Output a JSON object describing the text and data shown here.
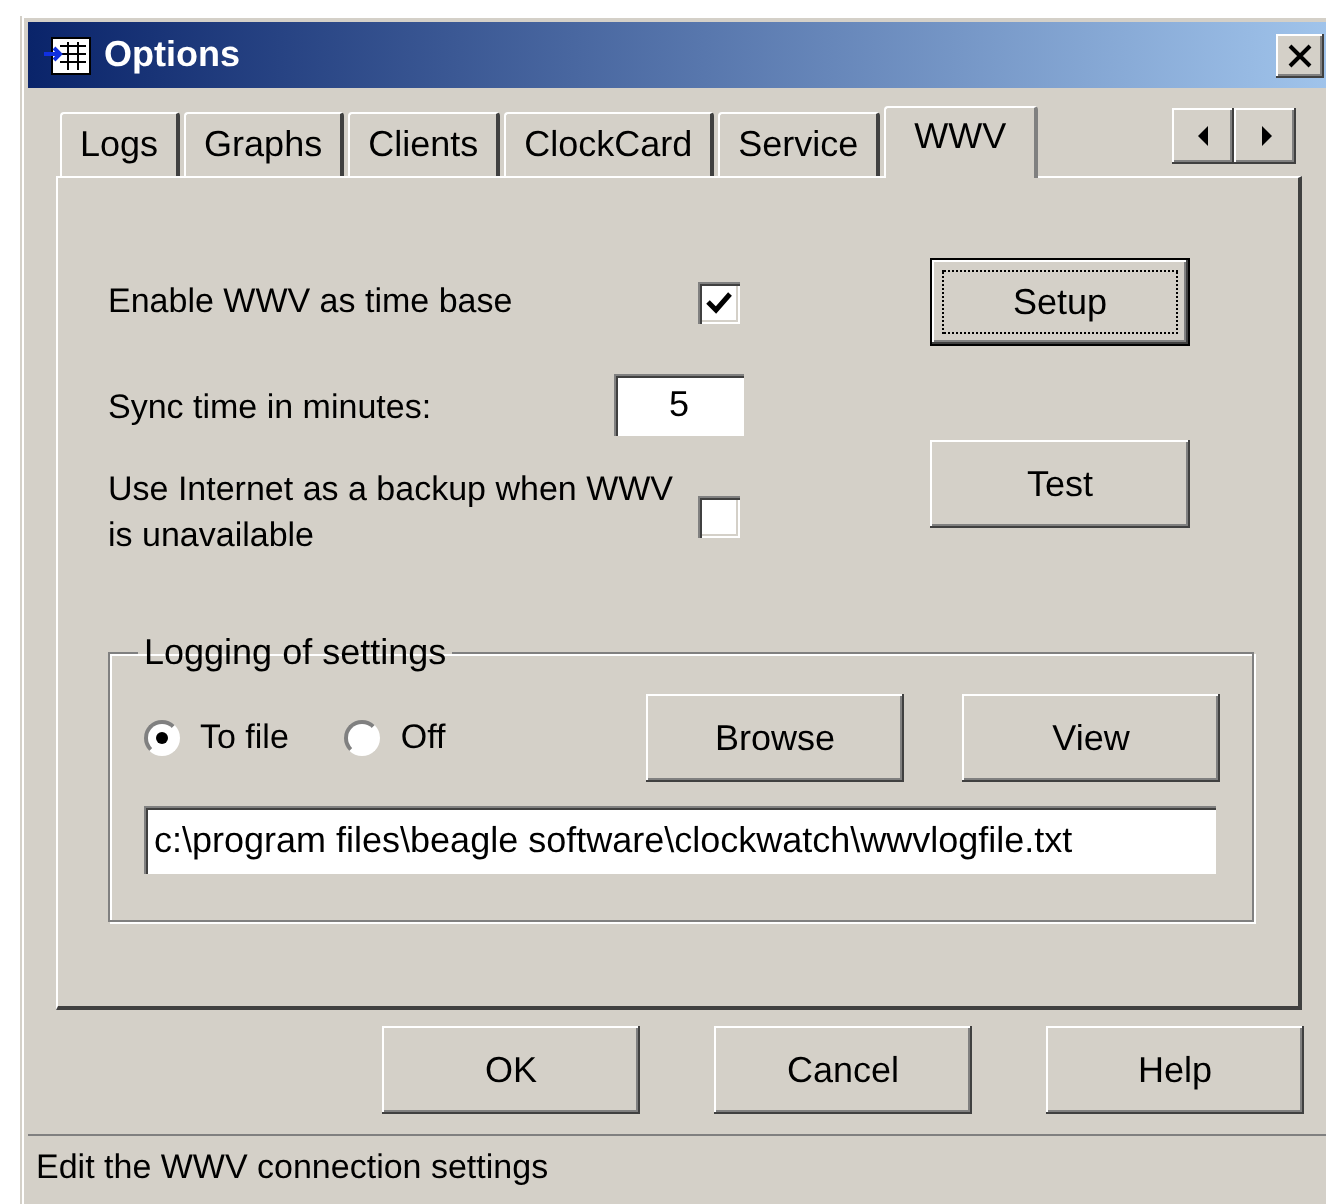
{
  "window": {
    "title": "Options"
  },
  "tabs": [
    {
      "label": "Logs",
      "selected": false
    },
    {
      "label": "Graphs",
      "selected": false
    },
    {
      "label": "Clients",
      "selected": false
    },
    {
      "label": "ClockCard",
      "selected": false
    },
    {
      "label": "Service",
      "selected": false
    },
    {
      "label": "WWV",
      "selected": true
    }
  ],
  "settings": {
    "enable_wwv": {
      "label": "Enable WWV as time base",
      "checked": true
    },
    "sync": {
      "label": "Sync time in minutes:",
      "value": "5"
    },
    "internet_backup": {
      "label": "Use Internet as a backup when WWV is unavailable",
      "checked": false
    }
  },
  "side_buttons": [
    {
      "label": "Setup",
      "default": true
    },
    {
      "label": "Test",
      "default": false
    }
  ],
  "logging": {
    "title": "Logging of settings",
    "options": [
      {
        "label": "To file",
        "selected": true
      },
      {
        "label": "Off",
        "selected": false
      }
    ],
    "buttons": [
      "Browse",
      "View"
    ],
    "path": "c:\\program files\\beagle software\\clockwatch\\wwvlogfile.txt"
  },
  "buttons": [
    "OK",
    "Cancel",
    "Help"
  ],
  "status_bar": "Edit the WWV connection settings"
}
